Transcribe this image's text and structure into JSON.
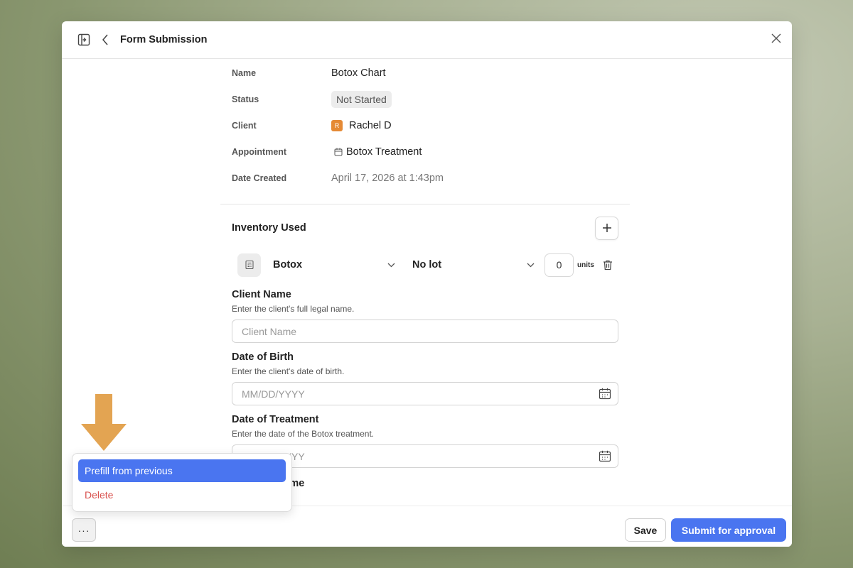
{
  "header": {
    "title": "Form Submission"
  },
  "meta": {
    "name_label": "Name",
    "name_value": "Botox Chart",
    "status_label": "Status",
    "status_value": "Not Started",
    "client_label": "Client",
    "client_initial": "R",
    "client_value": "Rachel D",
    "appointment_label": "Appointment",
    "appointment_value": "Botox Treatment",
    "date_label": "Date Created",
    "date_value": "April 17, 2026 at 1:43pm"
  },
  "inventory": {
    "title": "Inventory Used",
    "item": "Botox",
    "lot": "No lot",
    "quantity": "0",
    "units": "units"
  },
  "fields": {
    "client_name": {
      "label": "Client Name",
      "help": "Enter the client's full legal name.",
      "placeholder": "Client Name"
    },
    "dob": {
      "label": "Date of Birth",
      "help": "Enter the client's date of birth.",
      "placeholder": "MM/DD/YYYY"
    },
    "treatment_date": {
      "label": "Date of Treatment",
      "help": "Enter the date of the Botox treatment.",
      "placeholder": "MM/DD/YYYY"
    },
    "next_label": "Provider Name"
  },
  "footer": {
    "more": "···",
    "save": "Save",
    "submit": "Submit for approval"
  },
  "menu": {
    "prefill": "Prefill from previous",
    "delete": "Delete"
  },
  "colors": {
    "accent": "#4a75f0",
    "danger": "#d9534f",
    "arrow": "#e3a452",
    "avatar": "#e58a35"
  }
}
